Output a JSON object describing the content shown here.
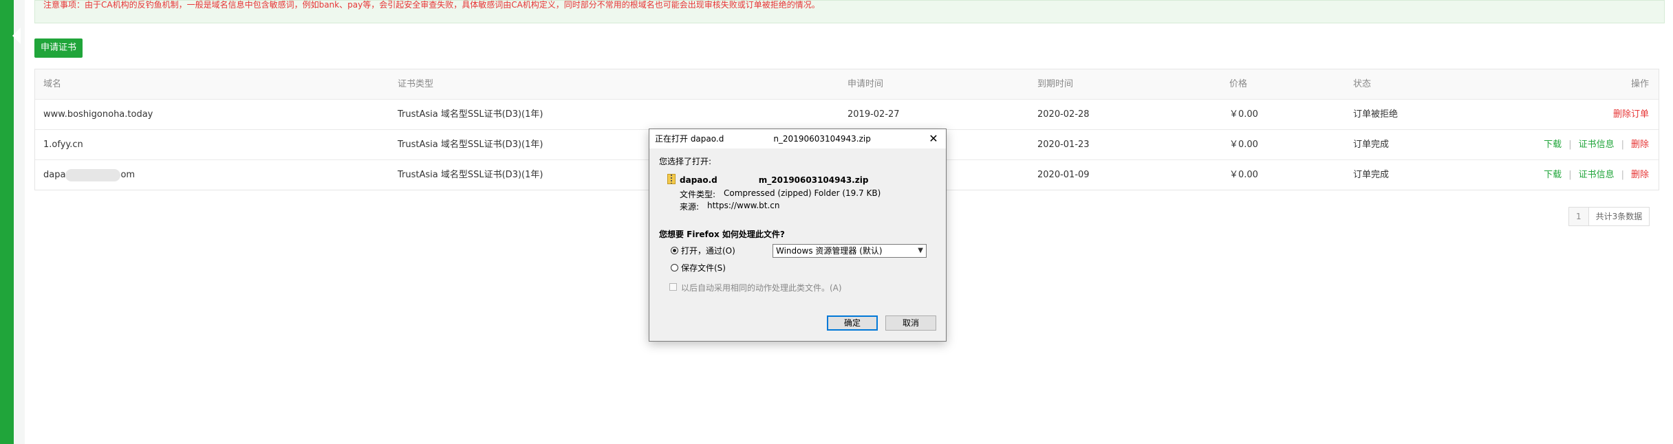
{
  "notice": "注意事项：由于CA机构的反钓鱼机制，一般是域名信息中包含敏感词，例如bank、pay等，会引起安全审查失败，具体敏感词由CA机构定义，同时部分不常用的根域名也可能会出现审核失败或订单被拒绝的情况。",
  "apply_button": "申请证书",
  "table": {
    "headers": [
      "域名",
      "证书类型",
      "申请时间",
      "到期时间",
      "价格",
      "状态",
      "操作"
    ],
    "rows": [
      {
        "domain": "www.boshigonoha.today",
        "type": "TrustAsia 域名型SSL证书(D3)(1年)",
        "apply": "2019-02-27",
        "expire": "2020-02-28",
        "price": "￥0.00",
        "status": "订单被拒绝",
        "action_delete_order": "删除订单"
      },
      {
        "domain": "1.ofyy.cn",
        "type": "TrustAsia 域名型SSL证书(D3)(1年)",
        "apply": "",
        "expire": "2020-01-23",
        "price": "￥0.00",
        "status": "订单完成",
        "action_download": "下载",
        "action_info": "证书信息",
        "action_delete": "删除"
      },
      {
        "domain_prefix": "dapa",
        "domain_suffix": "om",
        "type": "TrustAsia 域名型SSL证书(D3)(1年)",
        "apply": "",
        "expire": "2020-01-09",
        "price": "￥0.00",
        "status": "订单完成",
        "action_download": "下载",
        "action_info": "证书信息",
        "action_delete": "删除"
      }
    ]
  },
  "pagination": {
    "page": "1",
    "total": "共计3条数据"
  },
  "dialog": {
    "title": "正在打开 dapao.d　　　　　　n_20190603104943.zip",
    "chosen_label": "您选择了打开:",
    "filename": "dapao.d　　　　　m_20190603104943.zip",
    "type_label": "文件类型:",
    "type_value": "Compressed (zipped) Folder (19.7 KB)",
    "source_label": "来源:",
    "source_value": "https://www.bt.cn",
    "question": "您想要 Firefox 如何处理此文件?",
    "open_with_label": "打开，通过(O)",
    "open_with_value": "Windows 资源管理器 (默认)",
    "save_label": "保存文件(S)",
    "auto_label": "以后自动采用相同的动作处理此类文件。(A)",
    "ok": "确定",
    "cancel": "取消"
  },
  "colors": {
    "accent": "#20a53a",
    "danger": "#e63535"
  }
}
